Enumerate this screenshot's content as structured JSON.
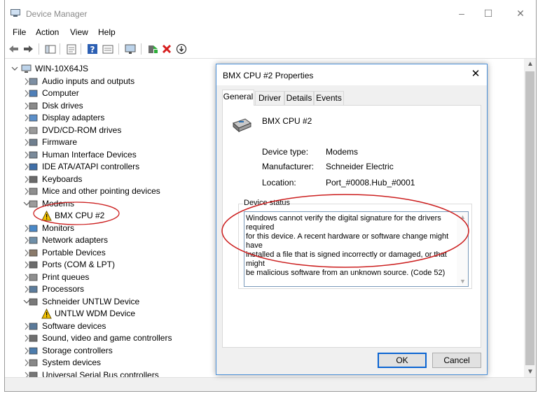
{
  "window": {
    "title": "Device Manager",
    "controls": {
      "minimize": "–",
      "maximize": "☐",
      "close": "✕"
    }
  },
  "menu": [
    "File",
    "Action",
    "View",
    "Help"
  ],
  "toolbar": {
    "icons": [
      "back-arrow-icon",
      "forward-arrow-icon",
      "show-hide-tree-icon",
      "properties-sheet-icon",
      "help-icon",
      "console-tree-icon",
      "monitor-icon",
      "update-driver-icon",
      "uninstall-icon",
      "scan-hardware-icon"
    ]
  },
  "tree": {
    "root": "WIN-10X64JS",
    "items": [
      {
        "label": "Audio inputs and outputs",
        "icon": "speaker-icon",
        "state": "collapsed"
      },
      {
        "label": "Computer",
        "icon": "computer-icon",
        "state": "collapsed"
      },
      {
        "label": "Disk drives",
        "icon": "disk-drive-icon",
        "state": "collapsed"
      },
      {
        "label": "Display adapters",
        "icon": "display-adapter-icon",
        "state": "collapsed"
      },
      {
        "label": "DVD/CD-ROM drives",
        "icon": "dvd-drive-icon",
        "state": "collapsed"
      },
      {
        "label": "Firmware",
        "icon": "firmware-icon",
        "state": "collapsed"
      },
      {
        "label": "Human Interface Devices",
        "icon": "hid-icon",
        "state": "collapsed"
      },
      {
        "label": "IDE ATA/ATAPI controllers",
        "icon": "ide-controller-icon",
        "state": "collapsed"
      },
      {
        "label": "Keyboards",
        "icon": "keyboard-icon",
        "state": "collapsed"
      },
      {
        "label": "Mice and other pointing devices",
        "icon": "mouse-icon",
        "state": "collapsed"
      },
      {
        "label": "Modems",
        "icon": "modem-icon",
        "state": "expanded"
      },
      {
        "label": "BMX CPU #2",
        "icon": "warning-modem-icon",
        "state": "child"
      },
      {
        "label": "Monitors",
        "icon": "monitor-icon",
        "state": "collapsed"
      },
      {
        "label": "Network adapters",
        "icon": "network-adapter-icon",
        "state": "collapsed"
      },
      {
        "label": "Portable Devices",
        "icon": "portable-device-icon",
        "state": "collapsed"
      },
      {
        "label": "Ports (COM & LPT)",
        "icon": "port-icon",
        "state": "collapsed"
      },
      {
        "label": "Print queues",
        "icon": "printer-icon",
        "state": "collapsed"
      },
      {
        "label": "Processors",
        "icon": "processor-icon",
        "state": "collapsed"
      },
      {
        "label": "Schneider UNTLW Device",
        "icon": "schneider-device-icon",
        "state": "expanded"
      },
      {
        "label": "UNTLW WDM Device",
        "icon": "warning-device-icon",
        "state": "child"
      },
      {
        "label": "Software devices",
        "icon": "software-device-icon",
        "state": "collapsed"
      },
      {
        "label": "Sound, video and game controllers",
        "icon": "sound-controller-icon",
        "state": "collapsed"
      },
      {
        "label": "Storage controllers",
        "icon": "storage-controller-icon",
        "state": "collapsed"
      },
      {
        "label": "System devices",
        "icon": "system-device-icon",
        "state": "collapsed"
      },
      {
        "label": "Universal Serial Bus controllers",
        "icon": "usb-controller-icon",
        "state": "collapsed"
      }
    ]
  },
  "dialog": {
    "title": "BMX CPU #2 Properties",
    "close": "✕",
    "tabs": [
      "General",
      "Driver",
      "Details",
      "Events"
    ],
    "active_tab": "General",
    "device_name": "BMX CPU #2",
    "props": {
      "type_label": "Device type:",
      "type_value": "Modems",
      "manufacturer_label": "Manufacturer:",
      "manufacturer_value": "Schneider Electric",
      "location_label": "Location:",
      "location_value": "Port_#0008.Hub_#0001"
    },
    "status_caption": "Device status",
    "status_lines": [
      "Windows cannot verify the digital signature for the drivers required",
      "for this device. A recent hardware or software change might have",
      "installed a file that is signed incorrectly or damaged, or that might",
      "be malicious software from an unknown source. (Code 52)"
    ],
    "ok": "OK",
    "cancel": "Cancel"
  },
  "colors": {
    "annotation": "#cc1f1f",
    "accent": "#0a64d2",
    "warning": "#f2c200"
  }
}
